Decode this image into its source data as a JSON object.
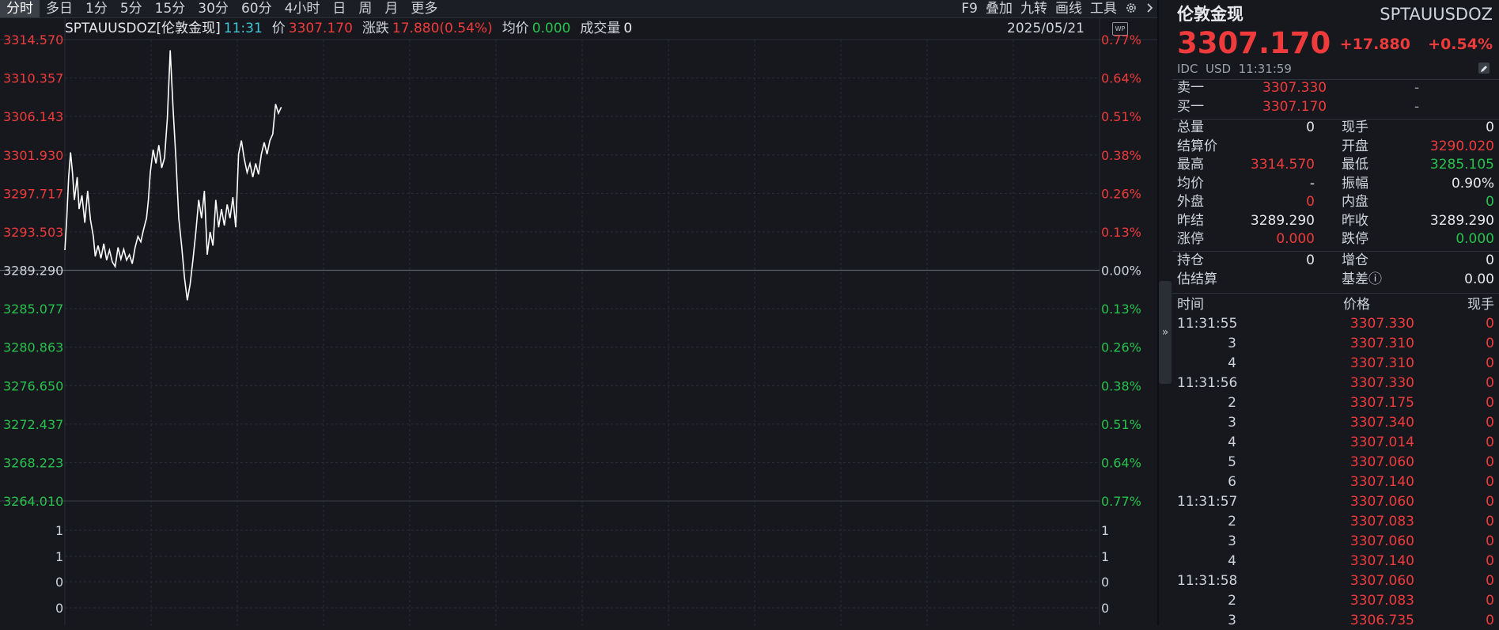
{
  "toolbar": {
    "tabs": [
      "分时",
      "多日",
      "1分",
      "5分",
      "15分",
      "30分",
      "60分",
      "4小时",
      "日",
      "周",
      "月",
      "更多"
    ],
    "active_tab": "分时",
    "tools": [
      "F9",
      "叠加",
      "九转",
      "画线",
      "工具"
    ],
    "gear_icon": "gear-icon",
    "more_icon": "chevron-right-icon"
  },
  "info": {
    "name": "SPTAUUSDOZ[伦敦金现]",
    "time": "11:31",
    "price_label": "价",
    "price": "3307.170",
    "change_label": "涨跌",
    "change": "17.880(0.54%)",
    "avg_label": "均价",
    "avg": "0.000",
    "volume_label": "成交量",
    "volume": "0",
    "date": "2025/05/21",
    "badge": "WP"
  },
  "chart_data": {
    "type": "line",
    "title": "",
    "prev_close": 3289.29,
    "ylim": [
      3264.01,
      3314.57
    ],
    "y_ticks_left": [
      "3314.570",
      "3310.357",
      "3306.143",
      "3301.930",
      "3297.717",
      "3293.503",
      "3289.290",
      "3285.077",
      "3280.863",
      "3276.650",
      "3272.437",
      "3268.223",
      "3264.010"
    ],
    "y_ticks_right": [
      "0.77%",
      "0.64%",
      "0.51%",
      "0.38%",
      "0.26%",
      "0.13%",
      "0.00%",
      "0.13%",
      "0.26%",
      "0.38%",
      "0.51%",
      "0.64%",
      "0.77%"
    ],
    "volume_ticks": [
      "1",
      "1",
      "0",
      "0"
    ],
    "colors": {
      "up": "#ef3b3b",
      "down": "#27c24c",
      "line": "#ffffff",
      "neutral": "#cfd3da"
    },
    "x_index": [
      0,
      2,
      4,
      6,
      8,
      10,
      13,
      15,
      18,
      21,
      24,
      27,
      30,
      32,
      35,
      38,
      41,
      44,
      47,
      50,
      53,
      56,
      59,
      62,
      65,
      68,
      71,
      74,
      77,
      80,
      83,
      86,
      88,
      90,
      93,
      96,
      99,
      102,
      105,
      108,
      111,
      114,
      117,
      120,
      123,
      126,
      129,
      132,
      135,
      138,
      141,
      144,
      147,
      150,
      153,
      156,
      159,
      162,
      165,
      168,
      171,
      174,
      177,
      180,
      183,
      186,
      189,
      192,
      195,
      198,
      201,
      204,
      207,
      210,
      213,
      216,
      219,
      222,
      225,
      228,
      231,
      234,
      237,
      240,
      243,
      246,
      249,
      252
    ],
    "x_total": 1090,
    "values": [
      3291.5,
      3295.0,
      3299.5,
      3302.2,
      3300.0,
      3297.0,
      3299.5,
      3296.0,
      3297.5,
      3294.5,
      3298.0,
      3294.8,
      3293.0,
      3290.8,
      3292.0,
      3290.6,
      3292.2,
      3290.4,
      3291.5,
      3290.2,
      3289.7,
      3291.8,
      3290.5,
      3291.6,
      3290.4,
      3291.0,
      3290.0,
      3291.8,
      3293.0,
      3292.4,
      3293.8,
      3295.0,
      3297.0,
      3300.0,
      3302.5,
      3301.0,
      3303.0,
      3300.5,
      3301.6,
      3306.0,
      3313.4,
      3307.0,
      3301.5,
      3295.0,
      3292.0,
      3288.5,
      3286.0,
      3287.8,
      3290.5,
      3293.5,
      3297.0,
      3295.0,
      3298.0,
      3291.0,
      3293.5,
      3292.0,
      3297.0,
      3294.0,
      3296.0,
      3294.2,
      3296.5,
      3295.0,
      3297.3,
      3294.0,
      3302.0,
      3303.5,
      3301.5,
      3300.0,
      3301.0,
      3299.5,
      3301.0,
      3299.8,
      3302.0,
      3303.3,
      3302.0,
      3303.5,
      3304.2,
      3307.5,
      3306.5,
      3307.17
    ]
  },
  "quote": {
    "name": "伦敦金现",
    "code": "SPTAUUSDOZ",
    "price": "3307.170",
    "change": "+17.880",
    "change_pct": "+0.54%",
    "exchange": "IDC",
    "currency": "USD",
    "time": "11:31:59",
    "edit_icon": "edit-icon",
    "ask_label": "卖一",
    "ask_price": "3307.330",
    "ask_vol": "-",
    "bid_label": "买一",
    "bid_price": "3307.170",
    "bid_vol": "-",
    "stats": [
      {
        "l1": "总量",
        "v1": "0",
        "c1": "white",
        "l2": "现手",
        "v2": "0",
        "c2": "white"
      },
      {
        "l1": "结算价",
        "v1": "",
        "c1": "white",
        "l2": "开盘",
        "v2": "3290.020",
        "c2": "red"
      },
      {
        "l1": "最高",
        "v1": "3314.570",
        "c1": "red",
        "l2": "最低",
        "v2": "3285.105",
        "c2": "green"
      },
      {
        "l1": "均价",
        "v1": "-",
        "c1": "white",
        "l2": "振幅",
        "v2": "0.90%",
        "c2": "white"
      },
      {
        "l1": "外盘",
        "v1": "0",
        "c1": "red",
        "l2": "内盘",
        "v2": "0",
        "c2": "green"
      },
      {
        "l1": "昨结",
        "v1": "3289.290",
        "c1": "white",
        "l2": "昨收",
        "v2": "3289.290",
        "c2": "white"
      },
      {
        "l1": "涨停",
        "v1": "0.000",
        "c1": "red",
        "l2": "跌停",
        "v2": "0.000",
        "c2": "green"
      }
    ],
    "stats2": [
      {
        "l1": "持仓",
        "v1": "0",
        "c1": "white",
        "l2": "增仓",
        "v2": "0",
        "c2": "white"
      },
      {
        "l1": "估结算",
        "v1": "",
        "c1": "white",
        "l2": "基差ⓘ",
        "v2": "0.00",
        "c2": "white"
      }
    ],
    "trades_header": {
      "time": "时间",
      "price": "价格",
      "vol": "现手"
    },
    "trades": [
      {
        "t": "11:31:55",
        "p": "3307.330",
        "v": "0"
      },
      {
        "t": "3",
        "p": "3307.310",
        "v": "0"
      },
      {
        "t": "4",
        "p": "3307.310",
        "v": "0"
      },
      {
        "t": "11:31:56",
        "p": "3307.330",
        "v": "0"
      },
      {
        "t": "2",
        "p": "3307.175",
        "v": "0"
      },
      {
        "t": "3",
        "p": "3307.340",
        "v": "0"
      },
      {
        "t": "4",
        "p": "3307.014",
        "v": "0"
      },
      {
        "t": "5",
        "p": "3307.060",
        "v": "0"
      },
      {
        "t": "6",
        "p": "3307.140",
        "v": "0"
      },
      {
        "t": "11:31:57",
        "p": "3307.060",
        "v": "0"
      },
      {
        "t": "2",
        "p": "3307.083",
        "v": "0"
      },
      {
        "t": "3",
        "p": "3307.060",
        "v": "0"
      },
      {
        "t": "4",
        "p": "3307.140",
        "v": "0"
      },
      {
        "t": "11:31:58",
        "p": "3307.060",
        "v": "0"
      },
      {
        "t": "2",
        "p": "3307.083",
        "v": "0"
      },
      {
        "t": "3",
        "p": "3306.735",
        "v": "0"
      }
    ],
    "splitter_icon": "double-chevron-right-icon"
  }
}
